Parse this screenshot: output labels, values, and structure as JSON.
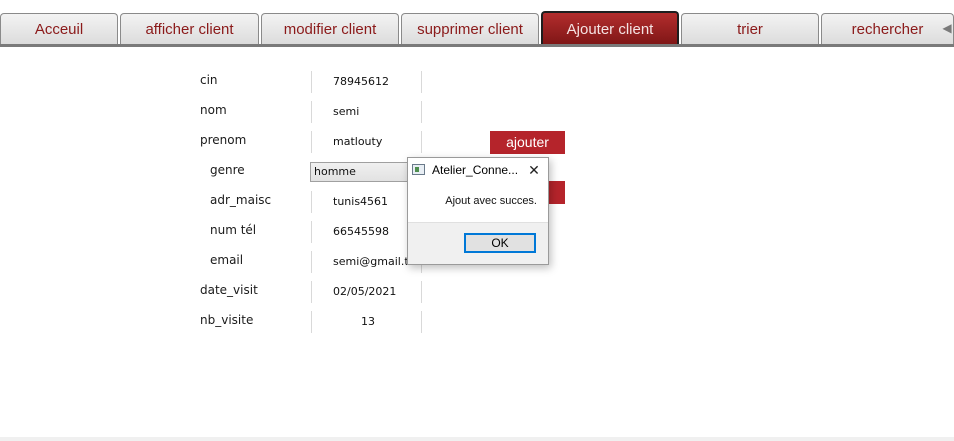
{
  "tabs": [
    {
      "label": "Acceuil",
      "active": false
    },
    {
      "label": "afficher client",
      "active": false
    },
    {
      "label": "modifier client",
      "active": false
    },
    {
      "label": "supprimer client",
      "active": false
    },
    {
      "label": "Ajouter client",
      "active": true
    },
    {
      "label": "trier",
      "active": false
    },
    {
      "label": "rechercher",
      "active": false
    }
  ],
  "tab_scroll_icon": "triangle-left-icon",
  "form": {
    "cin": {
      "label": "cin",
      "value": "78945612"
    },
    "nom": {
      "label": "nom",
      "value": "semi"
    },
    "prenom": {
      "label": "prenom",
      "value": "matlouty"
    },
    "genre": {
      "label": "genre",
      "value": "homme"
    },
    "adr_maisc": {
      "label": "adr_maisc",
      "value": "tunis4561"
    },
    "num_tel": {
      "label": "num tél",
      "value": "66545598"
    },
    "email": {
      "label": "email",
      "value": "semi@gmail.tn"
    },
    "date_visit": {
      "label": "date_visit",
      "value": "02/05/2021"
    },
    "nb_visite": {
      "label": "nb_visite",
      "value": "13"
    }
  },
  "buttons": {
    "ajouter": "ajouter"
  },
  "dialog": {
    "title": "Atelier_Conne...",
    "message": "Ajout avec succes.",
    "ok": "OK",
    "close_icon": "close-icon",
    "app_icon": "window-icon"
  },
  "colors": {
    "accent_red": "#b5242b",
    "tab_text": "#8b1a1a",
    "active_tab": "#9a2020",
    "focus_blue": "#0078d7"
  }
}
